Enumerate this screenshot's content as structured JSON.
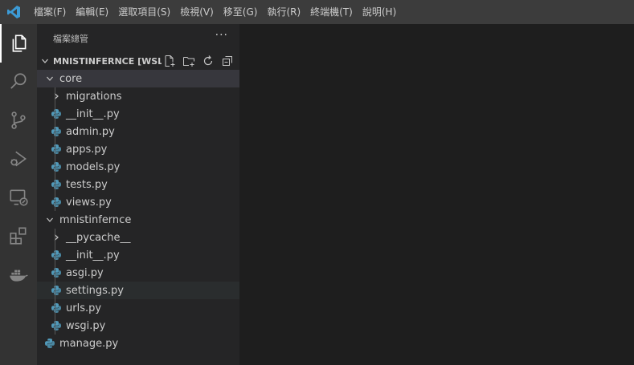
{
  "menubar": {
    "items": [
      "檔案(F)",
      "編輯(E)",
      "選取項目(S)",
      "檢視(V)",
      "移至(G)",
      "執行(R)",
      "終端機(T)",
      "說明(H)"
    ]
  },
  "sidebar": {
    "title": "檔案總管",
    "more": "···",
    "section_title": "MNISTINFERNCE [WSL: ..."
  },
  "tree": [
    {
      "label": "core",
      "type": "folder",
      "expanded": true,
      "depth": 0
    },
    {
      "label": "migrations",
      "type": "folder",
      "expanded": false,
      "depth": 1
    },
    {
      "label": "__init__.py",
      "type": "python",
      "depth": 1
    },
    {
      "label": "admin.py",
      "type": "python",
      "depth": 1
    },
    {
      "label": "apps.py",
      "type": "python",
      "depth": 1
    },
    {
      "label": "models.py",
      "type": "python",
      "depth": 1
    },
    {
      "label": "tests.py",
      "type": "python",
      "depth": 1
    },
    {
      "label": "views.py",
      "type": "python",
      "depth": 1
    },
    {
      "label": "mnistinfernce",
      "type": "folder",
      "expanded": true,
      "depth": 0
    },
    {
      "label": "__pycache__",
      "type": "folder",
      "expanded": false,
      "depth": 1
    },
    {
      "label": "__init__.py",
      "type": "python",
      "depth": 1
    },
    {
      "label": "asgi.py",
      "type": "python",
      "depth": 1
    },
    {
      "label": "settings.py",
      "type": "python",
      "depth": 1
    },
    {
      "label": "urls.py",
      "type": "python",
      "depth": 1
    },
    {
      "label": "wsgi.py",
      "type": "python",
      "depth": 1
    },
    {
      "label": "manage.py",
      "type": "python",
      "depth": 0
    }
  ],
  "icons": {
    "logo": "vscode-logo-icon",
    "activity": [
      "explorer-icon",
      "search-icon",
      "source-control-icon",
      "run-debug-icon",
      "remote-explorer-icon",
      "extensions-icon",
      "docker-icon"
    ],
    "section_actions": [
      "new-file-icon",
      "new-folder-icon",
      "refresh-icon",
      "collapse-all-icon"
    ]
  },
  "colors": {
    "accent": "#3c9bd6",
    "python_blue": "#519aba",
    "selected_row": "#37373d"
  }
}
